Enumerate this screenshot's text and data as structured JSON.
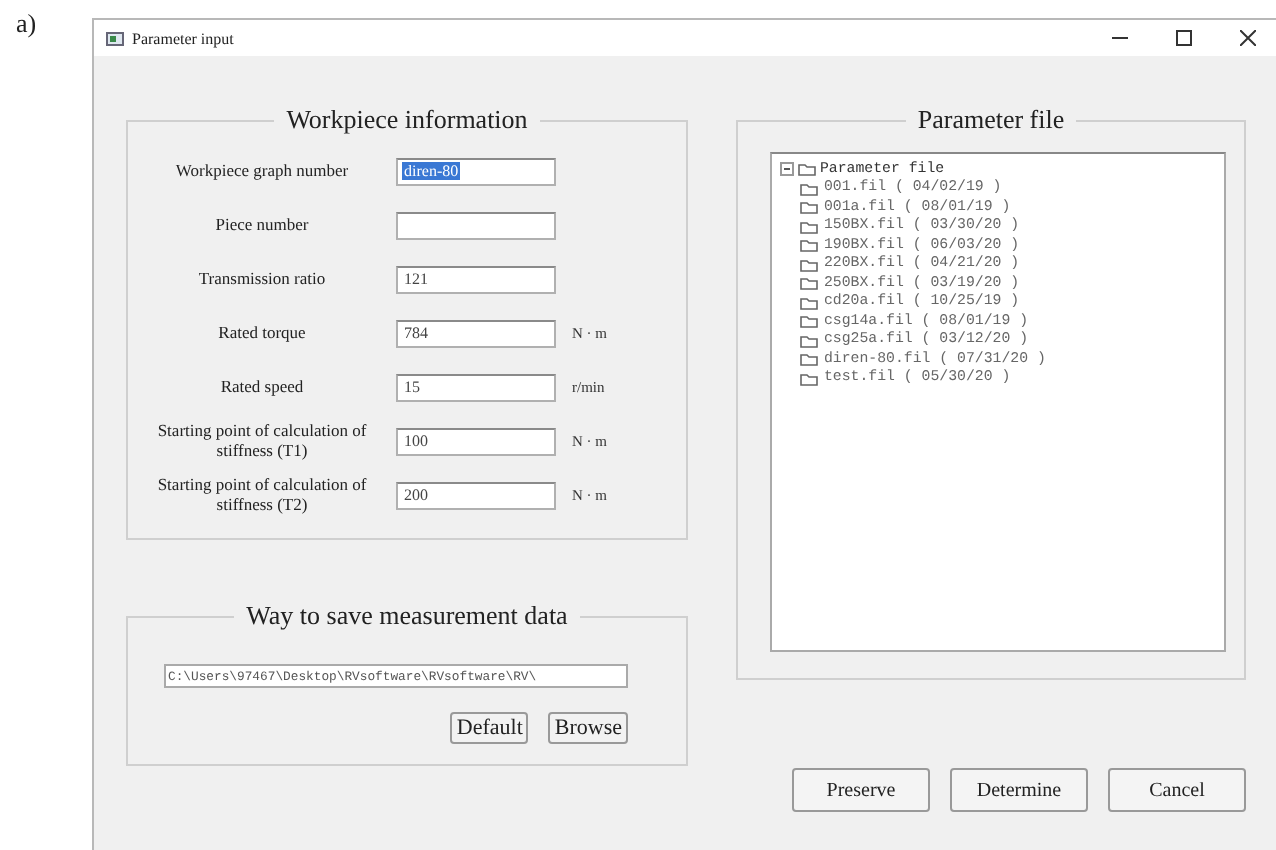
{
  "figure_label": "a)",
  "window": {
    "title": "Parameter input"
  },
  "workpiece": {
    "title": "Workpiece information",
    "fields": [
      {
        "label": "Workpiece graph number",
        "value": "diren-80",
        "selected": true
      },
      {
        "label": "Piece number",
        "selected": false
      },
      {
        "label": "Transmission ratio",
        "value": "121",
        "selected": false
      },
      {
        "label": "Rated torque",
        "value": "784",
        "unit": "N · m",
        "selected": false
      },
      {
        "label": "Rated speed",
        "value": "15",
        "unit": "r/min",
        "selected": false
      },
      {
        "label": "Starting point of calculation of stiffness (T1)",
        "value": "100",
        "unit": "N · m",
        "selected": false
      },
      {
        "label": "Starting point of calculation of stiffness (T2)",
        "value": "200",
        "unit": "N · m",
        "selected": false
      }
    ]
  },
  "save": {
    "title": "Way to save measurement data",
    "path": "C:\\Users\\97467\\Desktop\\RVsoftware\\RVsoftware\\RV\\",
    "buttons": [
      "Default",
      "Browse"
    ]
  },
  "parameter_file": {
    "title": "Parameter file",
    "tree": {
      "label": "Parameter file",
      "expanded": true,
      "children": [
        {
          "label": "001.fil ( 04/02/19 )"
        },
        {
          "label": "001a.fil ( 08/01/19 )"
        },
        {
          "label": "150BX.fil ( 03/30/20 )"
        },
        {
          "label": "190BX.fil ( 06/03/20 )"
        },
        {
          "label": "220BX.fil ( 04/21/20 )"
        },
        {
          "label": "250BX.fil ( 03/19/20 )"
        },
        {
          "label": "cd20a.fil ( 10/25/19 )"
        },
        {
          "label": "csg14a.fil ( 08/01/19 )"
        },
        {
          "label": "csg25a.fil ( 03/12/20 )"
        },
        {
          "label": "diren-80.fil ( 07/31/20 )"
        },
        {
          "label": "test.fil ( 05/30/20 )"
        }
      ]
    }
  },
  "buttons": [
    "Preserve",
    "Determine",
    "Cancel"
  ]
}
